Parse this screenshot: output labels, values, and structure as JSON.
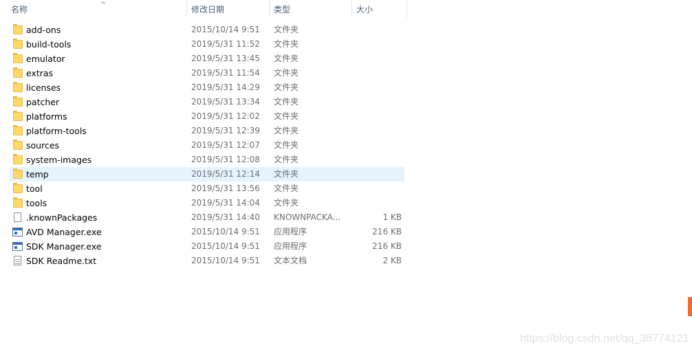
{
  "columns": {
    "name": "名称",
    "date": "修改日期",
    "type": "类型",
    "size": "大小"
  },
  "rows": [
    {
      "name": "add-ons",
      "date": "2015/10/14 9:51",
      "type": "文件夹",
      "size": "",
      "icon": "folder-icon"
    },
    {
      "name": "build-tools",
      "date": "2019/5/31 11:52",
      "type": "文件夹",
      "size": "",
      "icon": "folder-icon"
    },
    {
      "name": "emulator",
      "date": "2019/5/31 13:45",
      "type": "文件夹",
      "size": "",
      "icon": "folder-icon"
    },
    {
      "name": "extras",
      "date": "2019/5/31 11:54",
      "type": "文件夹",
      "size": "",
      "icon": "folder-icon"
    },
    {
      "name": "licenses",
      "date": "2019/5/31 14:29",
      "type": "文件夹",
      "size": "",
      "icon": "folder-icon"
    },
    {
      "name": "patcher",
      "date": "2019/5/31 13:34",
      "type": "文件夹",
      "size": "",
      "icon": "folder-icon"
    },
    {
      "name": "platforms",
      "date": "2019/5/31 12:02",
      "type": "文件夹",
      "size": "",
      "icon": "folder-icon"
    },
    {
      "name": "platform-tools",
      "date": "2019/5/31 12:39",
      "type": "文件夹",
      "size": "",
      "icon": "folder-icon"
    },
    {
      "name": "sources",
      "date": "2019/5/31 12:07",
      "type": "文件夹",
      "size": "",
      "icon": "folder-icon"
    },
    {
      "name": "system-images",
      "date": "2019/5/31 12:08",
      "type": "文件夹",
      "size": "",
      "icon": "folder-icon"
    },
    {
      "name": "temp",
      "date": "2019/5/31 12:14",
      "type": "文件夹",
      "size": "",
      "icon": "folder-icon",
      "hovered": true
    },
    {
      "name": "tool",
      "date": "2019/5/31 13:56",
      "type": "文件夹",
      "size": "",
      "icon": "folder-icon"
    },
    {
      "name": "tools",
      "date": "2019/5/31 14:04",
      "type": "文件夹",
      "size": "",
      "icon": "folder-icon"
    },
    {
      "name": ".knownPackages",
      "date": "2019/5/31 14:40",
      "type": "KNOWNPACKA...",
      "size": "1 KB",
      "icon": "file-icon"
    },
    {
      "name": "AVD Manager.exe",
      "date": "2015/10/14 9:51",
      "type": "应用程序",
      "size": "216 KB",
      "icon": "exe-icon"
    },
    {
      "name": "SDK Manager.exe",
      "date": "2015/10/14 9:51",
      "type": "应用程序",
      "size": "216 KB",
      "icon": "exe-icon"
    },
    {
      "name": "SDK Readme.txt",
      "date": "2015/10/14 9:51",
      "type": "文本文档",
      "size": "2 KB",
      "icon": "text-file-icon"
    }
  ],
  "watermark": "https://blog.csdn.net/qq_38774121",
  "colors": {
    "hover_row": "#e5f3ff",
    "header_text": "#4c607a",
    "folder": "#ffd966",
    "brand": "#f26a2a"
  }
}
